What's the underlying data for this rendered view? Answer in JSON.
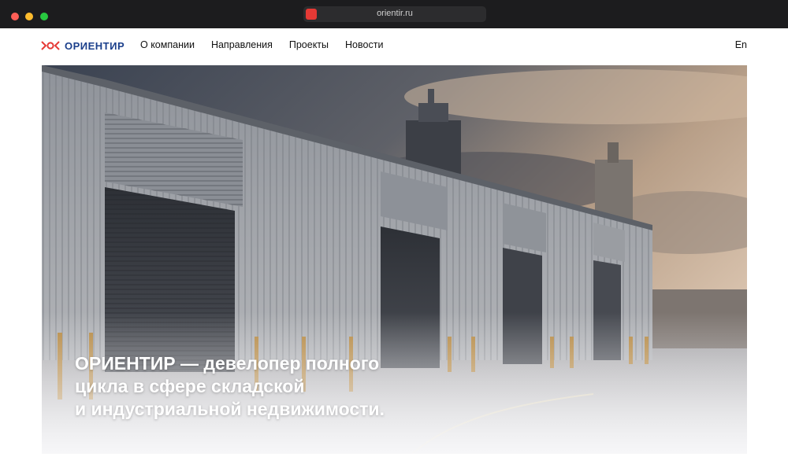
{
  "browser": {
    "url": "orientir.ru",
    "favicon_color": "#e53935"
  },
  "brand": {
    "name": "ОРИЕНТИР",
    "logo_icon": "brand-mark-icon",
    "primary_color": "#1b3f8b",
    "accent_color": "#e53935"
  },
  "nav": {
    "items": [
      {
        "label": "О компании"
      },
      {
        "label": "Направления"
      },
      {
        "label": "Проекты"
      },
      {
        "label": "Новости"
      }
    ],
    "language": "En"
  },
  "hero": {
    "image": "industrial-warehouse-photo",
    "heading_lines": [
      "ОРИЕНТИР — девелопер полного",
      "цикла в сфере складской",
      "и индустриальной недвижимости."
    ]
  }
}
